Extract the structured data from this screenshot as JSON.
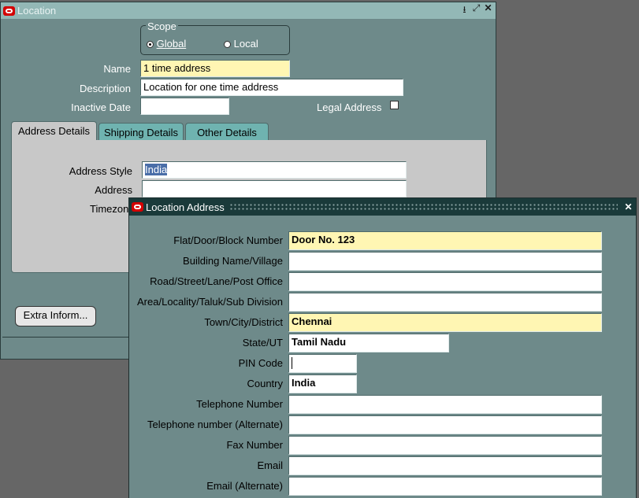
{
  "location_window": {
    "title": "Location",
    "scope": {
      "group_label": "Scope",
      "options": [
        "Global",
        "Local"
      ],
      "selected": "Global"
    },
    "name": {
      "label": "Name",
      "value": "1 time address"
    },
    "description": {
      "label": "Description",
      "value": "Location for one time address"
    },
    "inactive_date": {
      "label": "Inactive Date",
      "value": ""
    },
    "legal_address": {
      "label": "Legal Address",
      "checked": false
    },
    "tabs": [
      "Address Details",
      "Shipping Details",
      "Other Details"
    ],
    "active_tab": "Address Details",
    "address_style": {
      "label": "Address Style",
      "value": "India"
    },
    "address": {
      "label": "Address",
      "value": ""
    },
    "timezone": {
      "label": "Timezon"
    },
    "extra_button": "Extra Inform..."
  },
  "address_dialog": {
    "title": "Location Address",
    "fields": [
      {
        "label": "Flat/Door/Block Number",
        "value": "Door No. 123",
        "required": true
      },
      {
        "label": "Building Name/Village",
        "value": ""
      },
      {
        "label": "Road/Street/Lane/Post Office",
        "value": ""
      },
      {
        "label": "Area/Locality/Taluk/Sub Division",
        "value": ""
      },
      {
        "label": "Town/City/District",
        "value": "Chennai",
        "required": true
      },
      {
        "label": "State/UT",
        "value": "Tamil Nadu"
      },
      {
        "label": "PIN Code",
        "value": ""
      },
      {
        "label": "Country",
        "value": "India"
      },
      {
        "label": "Telephone Number",
        "value": ""
      },
      {
        "label": "Telephone number (Alternate)",
        "value": ""
      },
      {
        "label": "Fax Number",
        "value": ""
      },
      {
        "label": "Email",
        "value": ""
      },
      {
        "label": "Email (Alternate)",
        "value": ""
      }
    ]
  },
  "colors": {
    "window_bg": "#6e8a8a",
    "titlebar_inactive": "#93b8b6",
    "required_field": "#fff6b3",
    "tab_bg": "#6fb3b0",
    "panel_bg": "#c8c8c8"
  }
}
